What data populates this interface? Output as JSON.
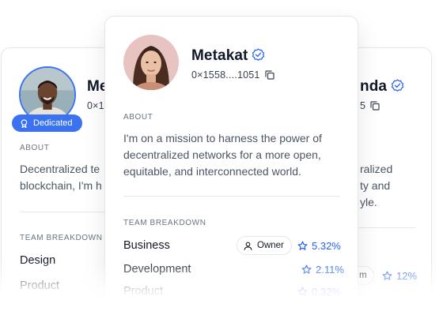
{
  "left_card": {
    "name": "Me",
    "address": "0×1",
    "badge": "Dedicated",
    "about_label": "ABOUT",
    "about_text_lines": [
      "Decentralized te",
      "blockchain, I'm h"
    ],
    "team_label": "TEAM BREAKDOWN",
    "teams": [
      "Design",
      "Product"
    ]
  },
  "center_card": {
    "name": "Metakat",
    "address": "0×1558....1051",
    "about_label": "ABOUT",
    "about_text_lines": [
      "I'm on a mission to harness the power of",
      "decentralized networks for a more open,",
      "equitable, and interconnected world."
    ],
    "team_label": "TEAM BREAKDOWN",
    "teams": [
      {
        "name": "Business",
        "role": "Owner",
        "percent": "5.32%"
      },
      {
        "name": "Development",
        "role": "",
        "percent": "2.11%"
      },
      {
        "name": "Product",
        "role": "",
        "percent": "0.32%"
      }
    ]
  },
  "right_card": {
    "name": "nda",
    "address": "5",
    "about_text_lines": [
      "ralized",
      "ty and",
      "yle."
    ],
    "team_row": {
      "role": "m",
      "percent": "12%"
    }
  },
  "colors": {
    "accent": "#2563eb",
    "badge_bg": "#3b72f2",
    "border": "#e5e7eb",
    "muted_text": "#6b7280"
  },
  "icons": {
    "verified": "verified-badge-icon",
    "copy": "copy-icon",
    "star": "star-icon",
    "user": "user-icon",
    "award": "award-icon"
  }
}
